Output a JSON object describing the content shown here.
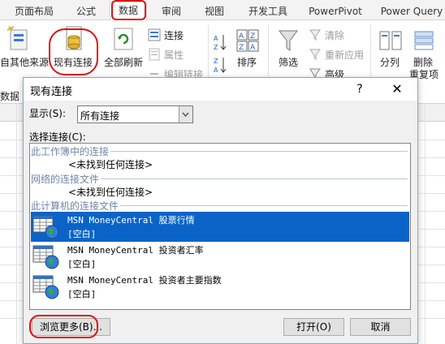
{
  "ribbon": {
    "tabs": [
      "页面布局",
      "公式",
      "数据",
      "审阅",
      "视图",
      "开发工具",
      "PowerPivot",
      "Power Query"
    ],
    "active_tab": "数据",
    "buttons": {
      "other_sources": "自其他来源",
      "existing_connections": "现有连接",
      "refresh_all": "全部刷新",
      "connections": "连接",
      "properties": "属性",
      "edit_links": "编辑链接",
      "sort": "排序",
      "filter": "筛选",
      "clear": "清除",
      "reapply": "重新应用",
      "advanced": "高级",
      "text_to_columns": "分列",
      "remove_duplicates": "删除",
      "duplicates_tail": "重复项",
      "group_label_data": "数据"
    }
  },
  "dialog": {
    "title": "现有连接",
    "help": "?",
    "close": "✕",
    "show_label": "显示(S):",
    "show_value": "所有连接",
    "choose_label": "选择连接(C):",
    "sections": [
      {
        "header": "此工作簿中的连接",
        "empty": "<未找到任何连接>"
      },
      {
        "header": "网络的连接文件",
        "empty": "<未找到任何连接>"
      },
      {
        "header": "此计算机的连接文件",
        "empty": ""
      }
    ],
    "connections": [
      {
        "name": "MSN MoneyCentral 股票行情",
        "desc": "[空白]",
        "selected": true
      },
      {
        "name": "MSN MoneyCentral 投资者汇率",
        "desc": "[空白]",
        "selected": false
      },
      {
        "name": "MSN MoneyCentral 投资者主要指数",
        "desc": "[空白]",
        "selected": false
      }
    ],
    "browse_button": "浏览更多(B)...",
    "open_button": "打开(O)",
    "cancel_button": "取消"
  },
  "colors": {
    "accent": "#0a64c8",
    "annotation": "#e01010",
    "section_text": "#6e87a8",
    "excel_green": "#217346"
  }
}
